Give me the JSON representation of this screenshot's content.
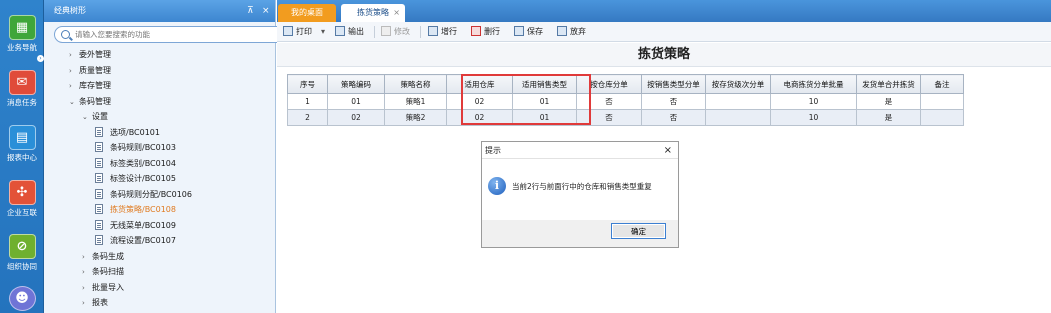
{
  "leftbar": {
    "items": [
      {
        "label": "业务导航",
        "icon": "grid-icon",
        "color": "#3fa63a"
      },
      {
        "label": "消息任务",
        "icon": "mail-icon",
        "color": "#e04b3a"
      },
      {
        "label": "报表中心",
        "icon": "report-icon",
        "color": "#2a8fd8"
      },
      {
        "label": "企业互联",
        "icon": "connect-icon",
        "color": "#e35238"
      },
      {
        "label": "组织协同",
        "icon": "collab-icon",
        "color": "#6fb02f"
      },
      {
        "label": "",
        "icon": "chat-icon",
        "color": "#6f74d6"
      }
    ]
  },
  "tree": {
    "title": "经典树形",
    "pin": "⊼",
    "close": "×",
    "search_placeholder": "请输入您要搜索的功能",
    "nodes": [
      {
        "label": "委外管理",
        "toggle": "›"
      },
      {
        "label": "质量管理",
        "toggle": "›"
      },
      {
        "label": "库存管理",
        "toggle": "›"
      },
      {
        "label": "条码管理",
        "toggle": "⌄"
      },
      {
        "label": "设置",
        "toggle": "⌄"
      },
      {
        "label": "选项/BC0101"
      },
      {
        "label": "条码规则/BC0103"
      },
      {
        "label": "标签类别/BC0104"
      },
      {
        "label": "标签设计/BC0105"
      },
      {
        "label": "条码规则分配/BC0106"
      },
      {
        "label": "拣货策略/BC0108",
        "active": true
      },
      {
        "label": "无线菜单/BC0109"
      },
      {
        "label": "流程设置/BC0107"
      },
      {
        "label": "条码生成",
        "toggle": "›"
      },
      {
        "label": "条码扫描",
        "toggle": "›"
      },
      {
        "label": "批量导入",
        "toggle": "›"
      },
      {
        "label": "报表",
        "toggle": "›"
      }
    ]
  },
  "tabs": [
    {
      "label": "我的桌面"
    },
    {
      "label": "拣货策略",
      "close": "×"
    }
  ],
  "toolbar": {
    "print": "打印",
    "export": "输出",
    "modify": "修改",
    "add_row": "增行",
    "del_row": "删行",
    "save": "保存",
    "abandon": "放弃"
  },
  "page_title": "拣货策略",
  "table": {
    "headers": [
      "序号",
      "策略编码",
      "策略名称",
      "适用仓库",
      "适用销售类型",
      "按仓库分单",
      "按销售类型分单",
      "按存货级次分单",
      "电商拣货分单批量",
      "发货单合并拣货",
      "备注"
    ],
    "rows": [
      [
        "1",
        "01",
        "策略1",
        "02",
        "01",
        "否",
        "否",
        "",
        "10",
        "是",
        ""
      ],
      [
        "2",
        "02",
        "策略2",
        "02",
        "01",
        "否",
        "否",
        "",
        "10",
        "是",
        ""
      ]
    ]
  },
  "dialog": {
    "title": "提示",
    "close": "×",
    "message": "当前2行与前面行中的仓库和销售类型重复",
    "ok": "确定"
  },
  "colors": {
    "accent": "#3579c2",
    "highlight_border": "#e03a3a",
    "selected_cell": "#8fd0f2",
    "active_node": "#e07b21"
  }
}
